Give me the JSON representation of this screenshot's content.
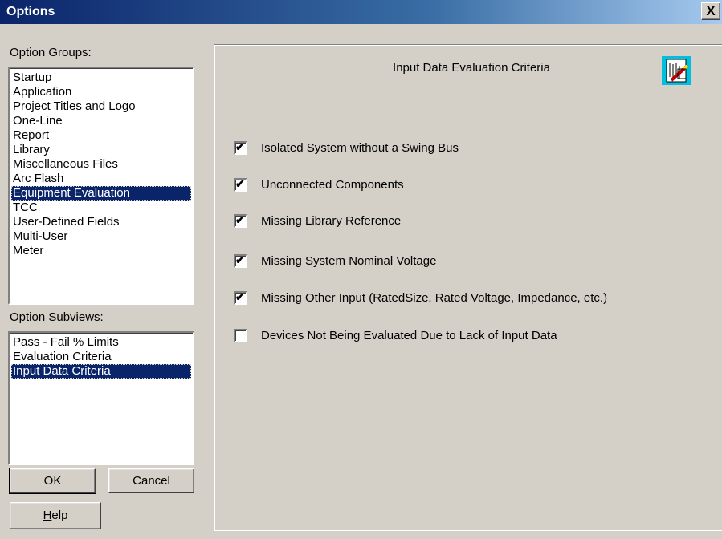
{
  "window": {
    "title": "Options",
    "close_glyph": "X"
  },
  "option_groups": {
    "label": "Option Groups:",
    "items": [
      {
        "label": "Startup",
        "selected": false
      },
      {
        "label": "Application",
        "selected": false
      },
      {
        "label": "Project Titles and Logo",
        "selected": false
      },
      {
        "label": "One-Line",
        "selected": false
      },
      {
        "label": "Report",
        "selected": false
      },
      {
        "label": "Library",
        "selected": false
      },
      {
        "label": "Miscellaneous Files",
        "selected": false
      },
      {
        "label": "Arc Flash",
        "selected": false
      },
      {
        "label": "Equipment Evaluation",
        "selected": true
      },
      {
        "label": "TCC",
        "selected": false
      },
      {
        "label": "User-Defined Fields",
        "selected": false
      },
      {
        "label": "Multi-User",
        "selected": false
      },
      {
        "label": "Meter",
        "selected": false
      }
    ]
  },
  "option_subviews": {
    "label": "Option Subviews:",
    "items": [
      {
        "label": "Pass - Fail % Limits",
        "selected": false
      },
      {
        "label": "Evaluation Criteria",
        "selected": false
      },
      {
        "label": "Input Data Criteria",
        "selected": true
      }
    ]
  },
  "buttons": {
    "ok": "OK",
    "cancel": "Cancel",
    "help": "Help"
  },
  "panel": {
    "title": "Input Data Evaluation Criteria",
    "icon": "evaluation-pencil-icon",
    "icon_color": "#00c0e0",
    "checkboxes": [
      {
        "label": "Isolated System without a Swing Bus",
        "checked": true
      },
      {
        "label": "Unconnected Components",
        "checked": true
      },
      {
        "label": "Missing Library Reference",
        "checked": true
      },
      {
        "label": "Missing System Nominal Voltage",
        "checked": true
      },
      {
        "label": "Missing Other Input (RatedSize, Rated Voltage, Impedance,  etc.)",
        "checked": true
      },
      {
        "label": "Devices Not Being Evaluated Due to Lack of Input Data",
        "checked": false
      }
    ]
  }
}
